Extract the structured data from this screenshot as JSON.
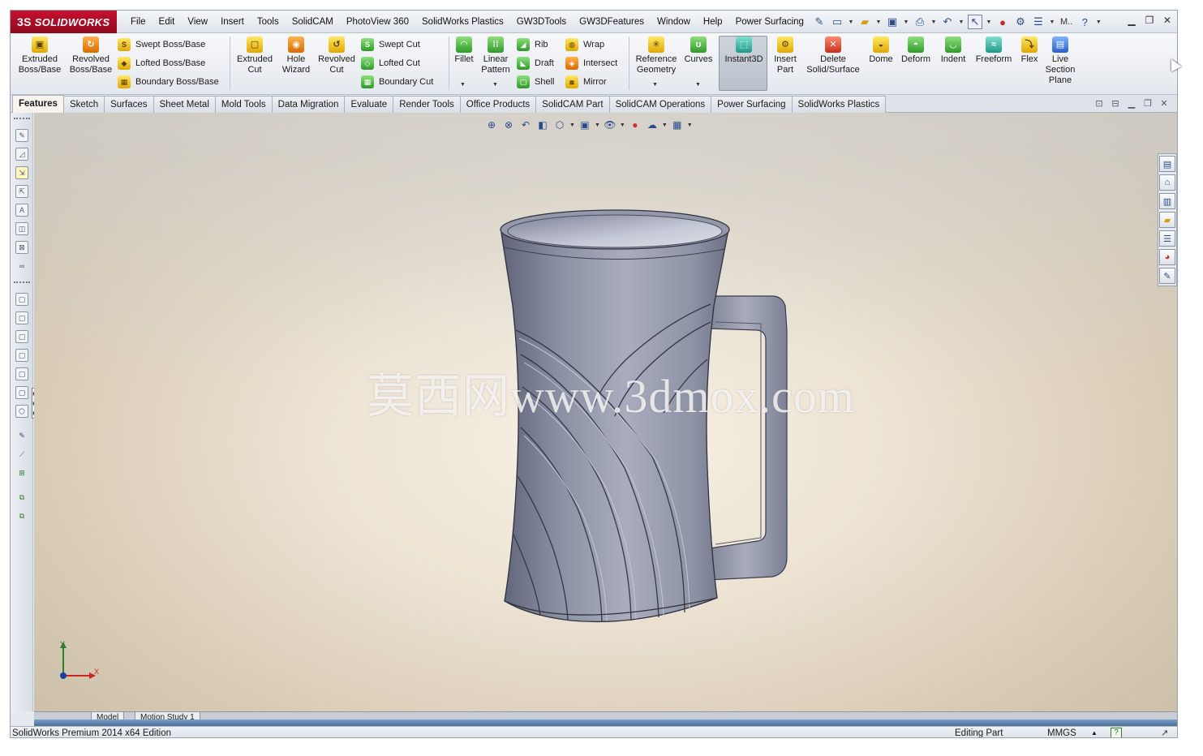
{
  "app": {
    "brand": "SOLIDWORKS",
    "brand_prefix": "3S"
  },
  "menu": [
    "File",
    "Edit",
    "View",
    "Insert",
    "Tools",
    "SolidCAM",
    "PhotoView 360",
    "SolidWorks Plastics",
    "GW3DTools",
    "GW3DFeatures",
    "Window",
    "Help",
    "Power Surfacing"
  ],
  "quickbar": {
    "icons": [
      "pin-icon",
      "new-document-icon",
      "open-icon",
      "save-icon",
      "print-icon",
      "undo-icon",
      "select-icon",
      "traffic-light-icon",
      "options-icon",
      "file-properties-icon"
    ],
    "m_label": "M..",
    "help_glyph": "?"
  },
  "commands": {
    "extruded_boss": "Extruded\nBoss/Base",
    "revolved_boss": "Revolved\nBoss/Base",
    "swept_boss": "Swept Boss/Base",
    "lofted_boss": "Lofted Boss/Base",
    "boundary_boss": "Boundary Boss/Base",
    "extruded_cut": "Extruded\nCut",
    "hole_wizard": "Hole\nWizard",
    "revolved_cut": "Revolved\nCut",
    "swept_cut": "Swept Cut",
    "lofted_cut": "Lofted Cut",
    "boundary_cut": "Boundary Cut",
    "fillet": "Fillet",
    "linear_pattern": "Linear\nPattern",
    "rib": "Rib",
    "draft": "Draft",
    "shell": "Shell",
    "wrap": "Wrap",
    "intersect": "Intersect",
    "mirror": "Mirror",
    "reference_geometry": "Reference\nGeometry",
    "curves": "Curves",
    "instant3d": "Instant3D",
    "insert_part": "Insert\nPart",
    "delete_solid": "Delete\nSolid/Surface",
    "dome": "Dome",
    "deform": "Deform",
    "indent": "Indent",
    "freeform": "Freeform",
    "flex": "Flex",
    "live_section": "Live\nSection\nPlane"
  },
  "tabs": [
    "Features",
    "Sketch",
    "Surfaces",
    "Sheet Metal",
    "Mold Tools",
    "Data Migration",
    "Evaluate",
    "Render Tools",
    "Office Products",
    "SolidCAM Part",
    "SolidCAM Operations",
    "Power Surfacing",
    "SolidWorks Plastics"
  ],
  "active_tab": "Features",
  "viewport": {
    "watermark": "莫西网www.3dmox.com",
    "triad_x": "X",
    "triad_y": "Y"
  },
  "model_tabs": [
    "Model",
    "Motion Study 1"
  ],
  "status": {
    "edition": "SolidWorks Premium 2014 x64 Edition",
    "mode": "Editing Part",
    "units": "MMGS",
    "arrow": "▲",
    "help": "?"
  },
  "colors": {
    "brand_red": "#c8102e",
    "mug_gray": "#8e93a6",
    "viewport_bg": "#ece3d3"
  }
}
